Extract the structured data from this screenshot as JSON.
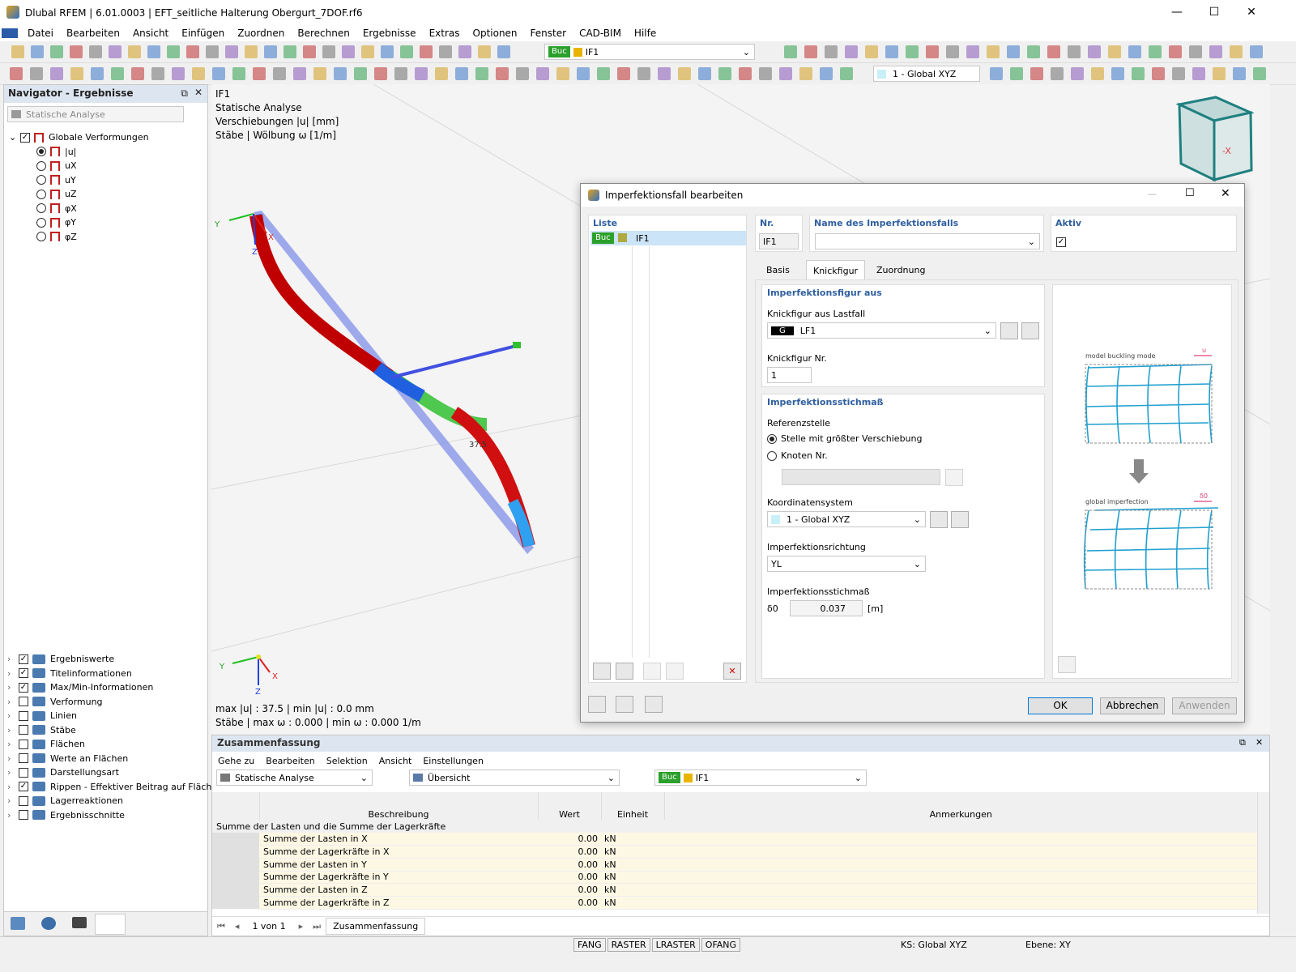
{
  "window": {
    "title": "Dlubal RFEM | 6.01.0003 | EFT_seitliche Halterung Obergurt_7DOF.rf6",
    "min": "—",
    "max": "☐",
    "close": "✕"
  },
  "menu": [
    "Datei",
    "Bearbeiten",
    "Ansicht",
    "Einfügen",
    "Zuordnen",
    "Berechnen",
    "Ergebnisse",
    "Extras",
    "Optionen",
    "Fenster",
    "CAD-BIM",
    "Hilfe"
  ],
  "toolbar": {
    "lc_tag": "Buc",
    "lc_name": "IF1",
    "cs": "1 - Global XYZ"
  },
  "navigator": {
    "title": "Navigator - Ergebnisse",
    "analysis": "Statische Analyse",
    "tree_root": "Globale Verformungen",
    "items": [
      "|u|",
      "uX",
      "uY",
      "uZ",
      "φX",
      "φY",
      "φZ"
    ],
    "bottom_items": [
      {
        "label": "Ergebniswerte",
        "checked": true
      },
      {
        "label": "Titelinformationen",
        "checked": true
      },
      {
        "label": "Max/Min-Informationen",
        "checked": true
      },
      {
        "label": "Verformung",
        "checked": false
      },
      {
        "label": "Linien",
        "checked": false
      },
      {
        "label": "Stäbe",
        "checked": false
      },
      {
        "label": "Flächen",
        "checked": false
      },
      {
        "label": "Werte an Flächen",
        "checked": false
      },
      {
        "label": "Darstellungsart",
        "checked": false
      },
      {
        "label": "Rippen - Effektiver Beitrag auf Fläch...",
        "checked": true
      },
      {
        "label": "Lagerreaktionen",
        "checked": false
      },
      {
        "label": "Ergebnisschnitte",
        "checked": false
      }
    ]
  },
  "viewport": {
    "line1": "IF1",
    "line2": "Statische Analyse",
    "line3": "Verschiebungen |u| [mm]",
    "line4": "Stäbe | Wölbung ω [1/m]",
    "bottom1": "max |u| : 37.5 | min |u| : 0.0 mm",
    "bottom2": "Stäbe | max ω : 0.000 | min ω : 0.000 1/m",
    "value_label": "37.5",
    "axis_x": "X",
    "axis_y": "Y",
    "axis_z": "Z",
    "cube_x": "-X"
  },
  "dialog": {
    "title": "Imperfektionsfall bearbeiten",
    "list_title": "Liste",
    "list_tag": "Buc",
    "list_item": "IF1",
    "nr_label": "Nr.",
    "nr_value": "IF1",
    "name_label": "Name des Imperfektionsfalls",
    "active_label": "Aktiv",
    "tabs": [
      "Basis",
      "Knickfigur",
      "Zuordnung"
    ],
    "sec1": "Imperfektionsfigur aus",
    "knick_lf_label": "Knickfigur aus Lastfall",
    "lf_tag": "G",
    "lf_name": "LF1",
    "knick_nr_label": "Knickfigur Nr.",
    "knick_nr": "1",
    "sec2": "Imperfektionsstichmaß",
    "ref_label": "Referenzstelle",
    "radio1": "Stelle mit größter Verschiebung",
    "radio2": "Knoten Nr.",
    "ks_label": "Koordinatensystem",
    "ks_value": "1 - Global XYZ",
    "dir_label": "Imperfektionsrichtung",
    "dir_value": "YL",
    "stich_label": "Imperfektionsstichmaß",
    "delta_label": "δ0",
    "delta_value": "0.037",
    "unit": "[m]",
    "img_cap1": "model buckling mode",
    "img_cap2": "global imperfection",
    "img_u": "u",
    "img_d": "δ0",
    "ok": "OK",
    "cancel": "Abbrechen",
    "apply": "Anwenden"
  },
  "summary": {
    "title": "Zusammenfassung",
    "menu": [
      "Gehe zu",
      "Bearbeiten",
      "Selektion",
      "Ansicht",
      "Einstellungen"
    ],
    "analysis": "Statische Analyse",
    "view": "Übersicht",
    "lc_tag": "Buc",
    "lc_name": "IF1",
    "cols": [
      "Beschreibung",
      "Wert",
      "Einheit",
      "Anmerkungen"
    ],
    "group": "Summe der Lasten und die Summe der Lagerkräfte",
    "rows": [
      {
        "d": "Summe der Lasten in X",
        "v": "0.00",
        "u": "kN"
      },
      {
        "d": "Summe der Lagerkräfte in X",
        "v": "0.00",
        "u": "kN"
      },
      {
        "d": "Summe der Lasten in Y",
        "v": "0.00",
        "u": "kN"
      },
      {
        "d": "Summe der Lagerkräfte in Y",
        "v": "0.00",
        "u": "kN"
      },
      {
        "d": "Summe der Lasten in Z",
        "v": "0.00",
        "u": "kN"
      },
      {
        "d": "Summe der Lagerkräfte in Z",
        "v": "0.00",
        "u": "kN"
      }
    ],
    "pager": "1 von 1",
    "tab": "Zusammenfassung"
  },
  "status": {
    "items": [
      "FANG",
      "RASTER",
      "LRASTER",
      "OFANG"
    ],
    "ks": "KS: Global XYZ",
    "ebene": "Ebene: XY"
  }
}
